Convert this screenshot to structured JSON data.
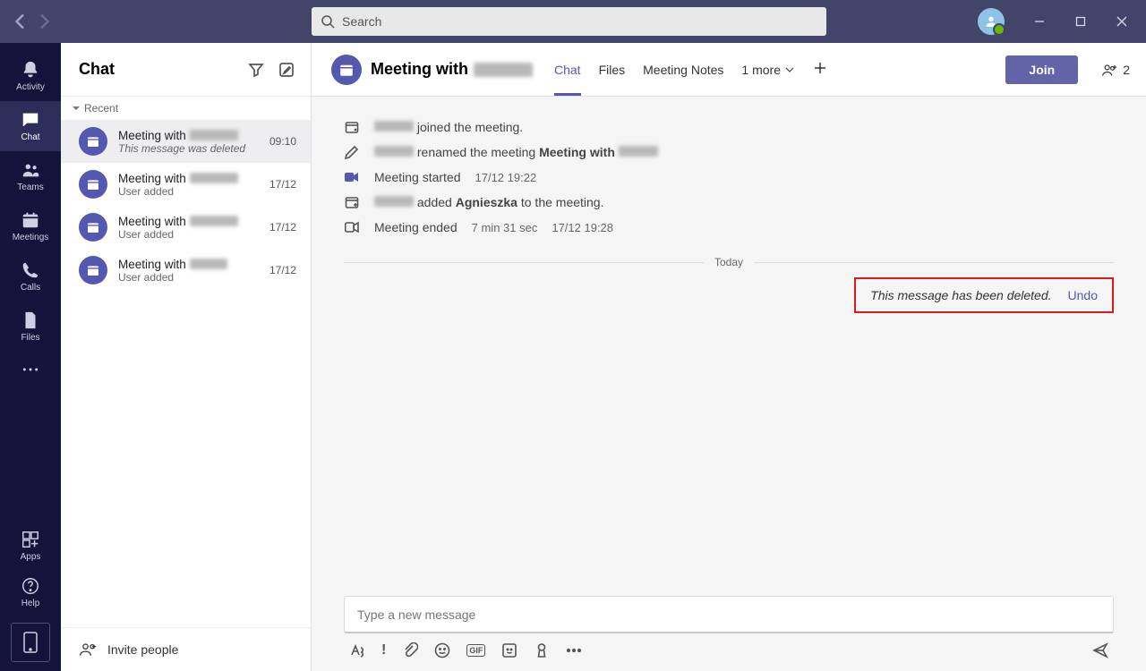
{
  "titlebar": {
    "search_placeholder": "Search"
  },
  "rail": {
    "items": [
      {
        "label": "Activity"
      },
      {
        "label": "Chat"
      },
      {
        "label": "Teams"
      },
      {
        "label": "Meetings"
      },
      {
        "label": "Calls"
      },
      {
        "label": "Files"
      }
    ],
    "apps_label": "Apps",
    "help_label": "Help"
  },
  "listpanel": {
    "title": "Chat",
    "section": "Recent",
    "items": [
      {
        "title_prefix": "Meeting with",
        "subtitle": "This message was deleted",
        "time": "09:10",
        "subtitle_italic": true
      },
      {
        "title_prefix": "Meeting with",
        "subtitle": "User added",
        "time": "17/12",
        "subtitle_italic": false
      },
      {
        "title_prefix": "Meeting with",
        "subtitle": "User added",
        "time": "17/12",
        "subtitle_italic": false
      },
      {
        "title_prefix": "Meeting with",
        "subtitle": "User added",
        "time": "17/12",
        "subtitle_italic": false
      }
    ],
    "invite": "Invite people"
  },
  "chatheader": {
    "title_prefix": "Meeting with",
    "tabs": [
      "Chat",
      "Files",
      "Meeting Notes"
    ],
    "more": "1 more",
    "join": "Join",
    "people_count": "2"
  },
  "conversation": {
    "joined_suffix": "joined the meeting.",
    "renamed_mid": "renamed the meeting",
    "renamed_bold": "Meeting with",
    "started": "Meeting started",
    "started_time": "17/12 19:22",
    "added_mid": "added",
    "added_name": "Agnieszka",
    "added_suffix": "to the meeting.",
    "ended": "Meeting ended",
    "ended_duration": "7 min 31 sec",
    "ended_time": "17/12 19:28",
    "today": "Today",
    "deleted_text": "This message has been deleted.",
    "undo": "Undo"
  },
  "composer": {
    "placeholder": "Type a new message"
  }
}
